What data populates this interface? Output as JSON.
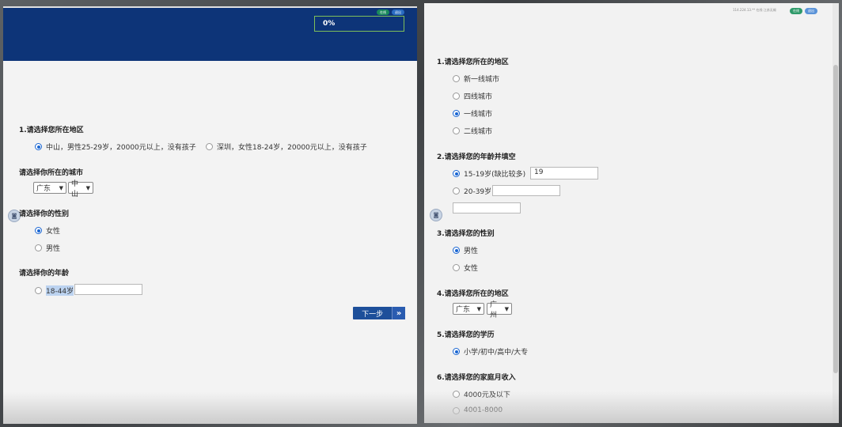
{
  "left": {
    "progress": "0%",
    "badges": [
      "在线",
      "退出"
    ],
    "questions": {
      "q1": {
        "title": "1.请选择您所在地区",
        "options": [
          "中山，男性25-29岁，20000元以上，没有孩子",
          "深圳，女性18-24岁，20000元以上，没有孩子"
        ],
        "selected": 0
      },
      "city": {
        "title": "请选择你所在的城市",
        "province": "广东",
        "city": "中山"
      },
      "gender": {
        "title": "请选择你的性别",
        "options": [
          "女性",
          "男性"
        ],
        "selected": 0
      },
      "age": {
        "title": "请选择你的年龄",
        "options": [
          "18-44岁"
        ],
        "input_value": ""
      }
    },
    "next_button": "下一步"
  },
  "right": {
    "top_info": "114.224.13.**  在线  江苏无锡",
    "badges": [
      "在线",
      "退出"
    ],
    "questions": {
      "q1": {
        "title": "1.请选择您所在的地区",
        "options": [
          "新一线城市",
          "四线城市",
          "一线城市",
          "二线城市"
        ],
        "selected": 2
      },
      "q2": {
        "title": "2.请选择您的年龄并填空",
        "options": [
          "15-19岁(缺比较多)",
          "20-39岁"
        ],
        "selected": 0,
        "input1_value": "19",
        "input2_value": "",
        "input3_value": ""
      },
      "q3": {
        "title": "3.请选择您的性别",
        "options": [
          "男性",
          "女性"
        ],
        "selected": 0
      },
      "q4": {
        "title": "4.请选择您所在的地区",
        "province": "广东",
        "city": "广州"
      },
      "q5": {
        "title": "5.请选择您的学历",
        "options": [
          "小学/初中/高中/大专"
        ],
        "selected": 0
      },
      "q6": {
        "title": "6.请选择您的家庭月收入",
        "options": [
          "4000元及以下",
          "4001-8000"
        ]
      }
    }
  },
  "colors": {
    "header_blue": "#0d3478",
    "radio_blue": "#1a66d2",
    "button_blue": "#1d4f9a"
  }
}
